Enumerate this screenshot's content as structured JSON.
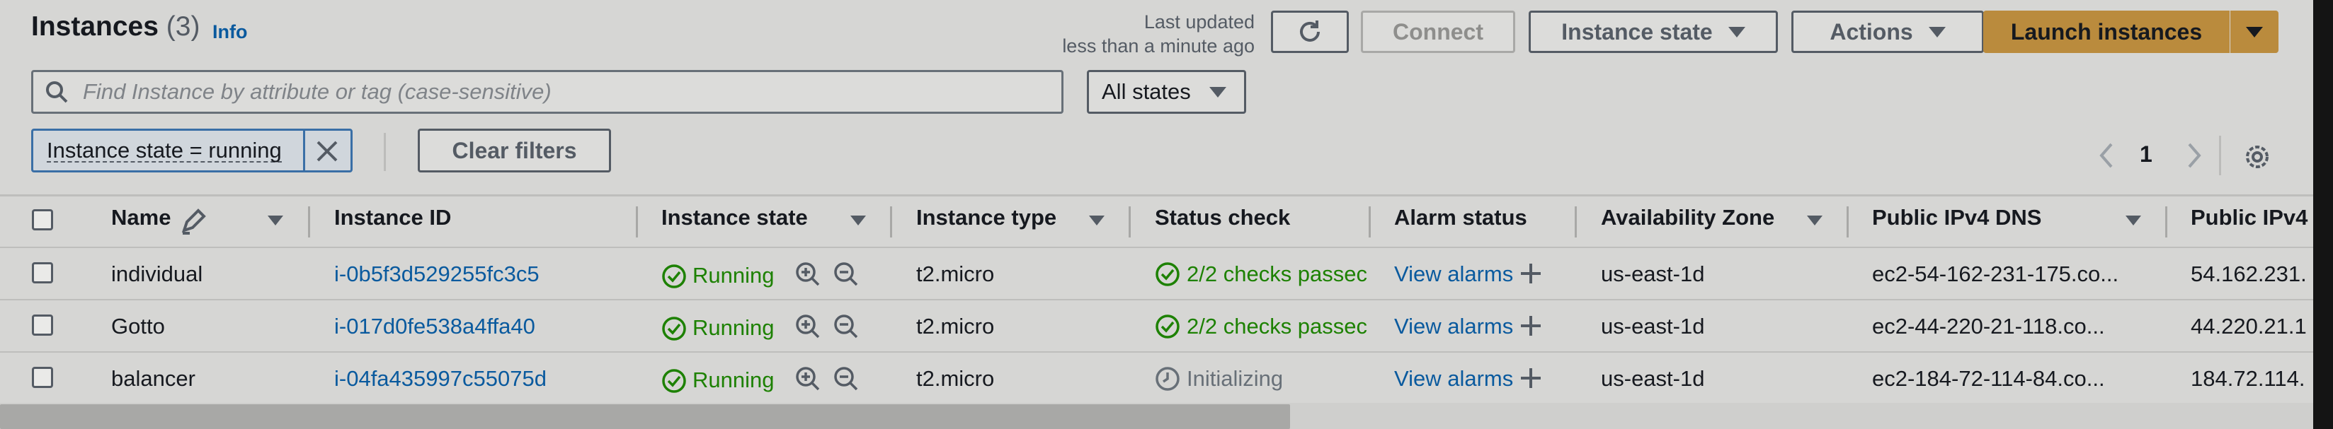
{
  "header": {
    "title": "Instances",
    "count": "(3)",
    "info": "Info",
    "last_updated_line1": "Last updated",
    "last_updated_line2": "less than a minute ago",
    "connect": "Connect",
    "instance_state": "Instance state",
    "actions": "Actions",
    "launch": "Launch instances"
  },
  "filter": {
    "search_placeholder": "Find Instance by attribute or tag (case-sensitive)",
    "states_select": "All states",
    "token": "Instance state = running",
    "clear": "Clear filters"
  },
  "pagination": {
    "page": "1"
  },
  "table": {
    "columns": [
      "Name",
      "Instance ID",
      "Instance state",
      "Instance type",
      "Status check",
      "Alarm status",
      "Availability Zone",
      "Public IPv4 DNS",
      "Public IPv4"
    ],
    "rows": [
      {
        "name": "individual",
        "id": "i-0b5f3d529255fc3c5",
        "state": "Running",
        "type": "t2.micro",
        "status": "2/2 checks passec",
        "alarm": "View alarms",
        "az": "us-east-1d",
        "dns": "ec2-54-162-231-175.co...",
        "ip": "54.162.231."
      },
      {
        "name": "Gotto",
        "id": "i-017d0fe538a4ffa40",
        "state": "Running",
        "type": "t2.micro",
        "status": "2/2 checks passec",
        "alarm": "View alarms",
        "az": "us-east-1d",
        "dns": "ec2-44-220-21-118.co...",
        "ip": "44.220.21.1"
      },
      {
        "name": "balancer",
        "id": "i-04fa435997c55075d",
        "state": "Running",
        "type": "t2.micro",
        "status": "Initializing",
        "alarm": "View alarms",
        "az": "us-east-1d",
        "dns": "ec2-184-72-114-84.co...",
        "ip": "184.72.114."
      }
    ]
  },
  "colors": {
    "link": "#0a5a9e",
    "running": "#1d8102",
    "primary": "#ba8b3d",
    "background": "#d6d6d4"
  }
}
